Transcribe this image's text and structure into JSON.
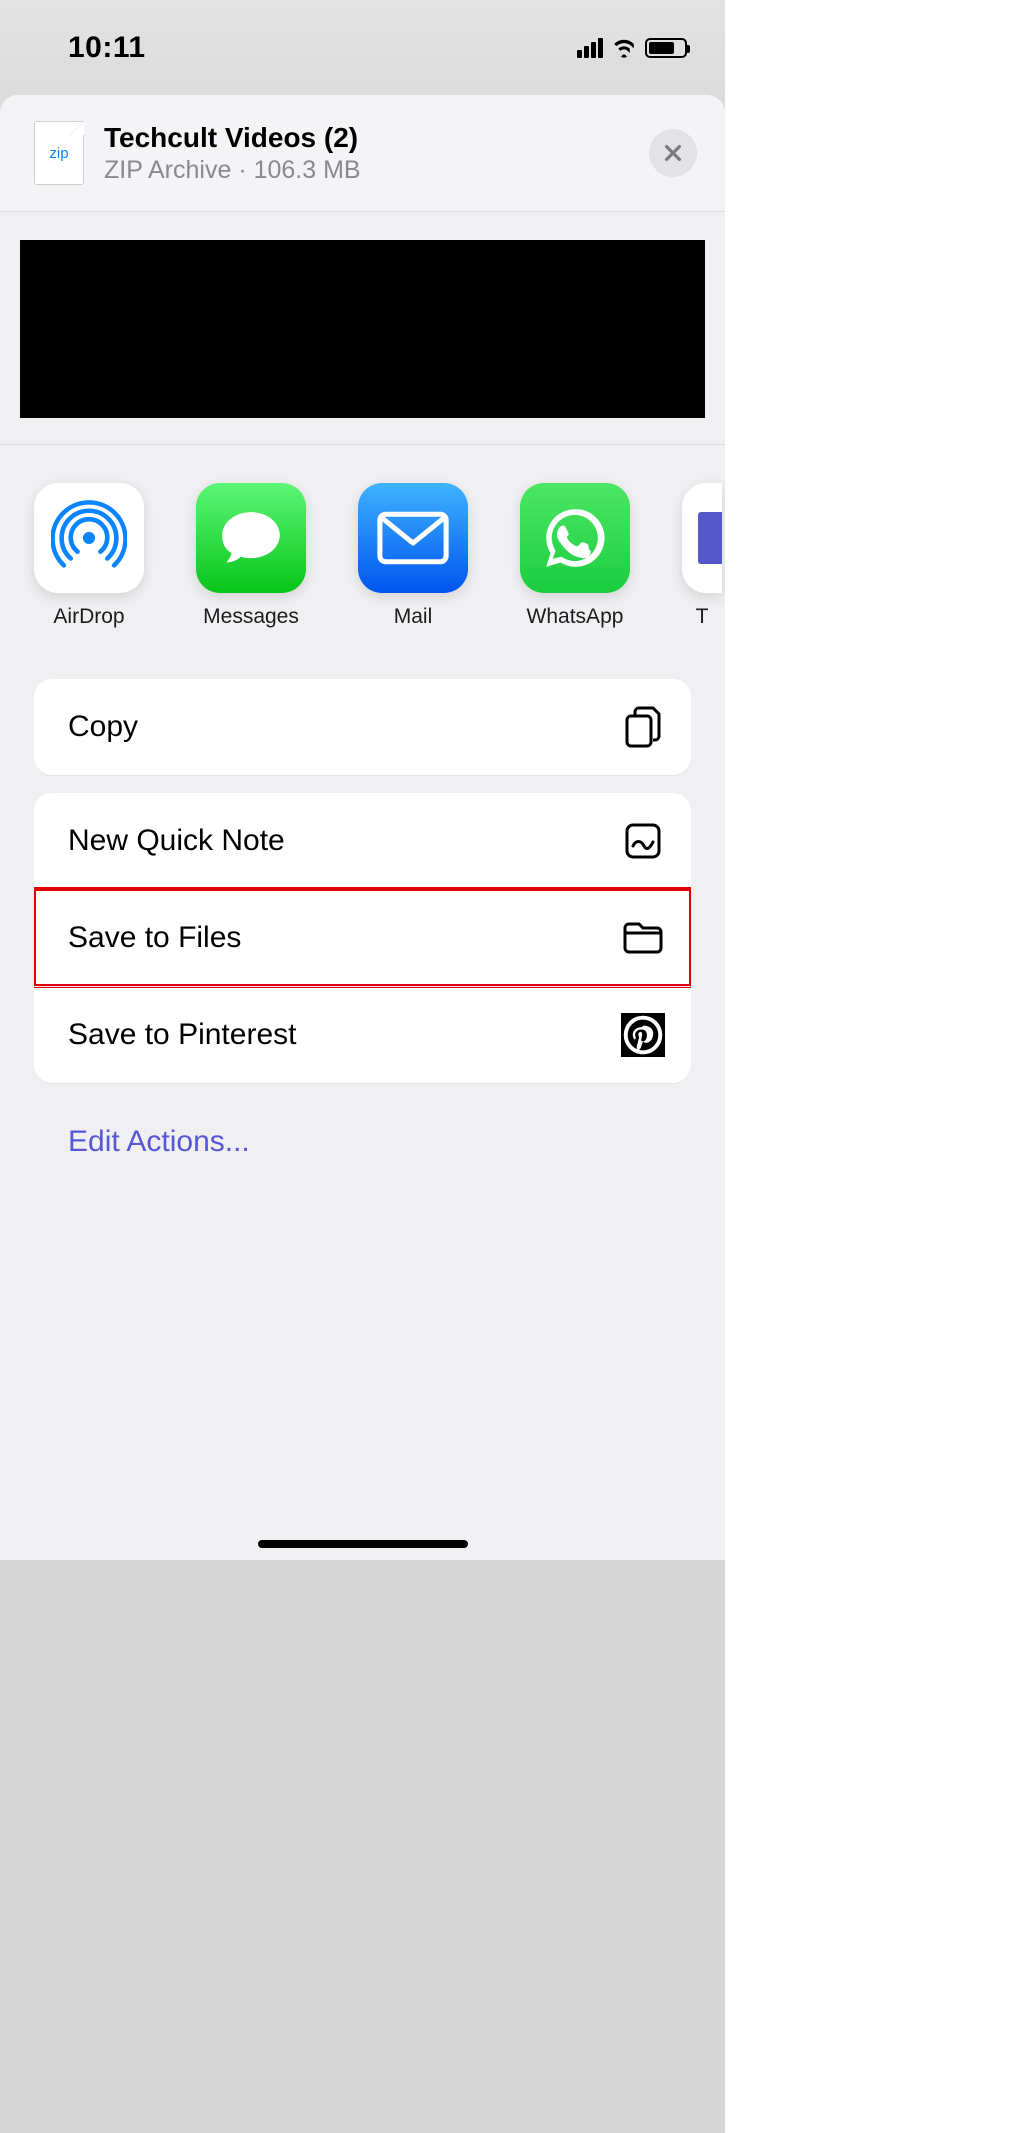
{
  "status": {
    "time": "10:11"
  },
  "file": {
    "name": "Techcult Videos (2)",
    "type": "ZIP Archive",
    "size": "106.3 MB",
    "thumb_label": "zip"
  },
  "apps": [
    {
      "label": "AirDrop"
    },
    {
      "label": "Messages"
    },
    {
      "label": "Mail"
    },
    {
      "label": "WhatsApp"
    },
    {
      "label": "T"
    }
  ],
  "actions": {
    "copy": "Copy",
    "quick_note": "New Quick Note",
    "save_files": "Save to Files",
    "save_pinterest": "Save to Pinterest",
    "edit": "Edit Actions..."
  }
}
